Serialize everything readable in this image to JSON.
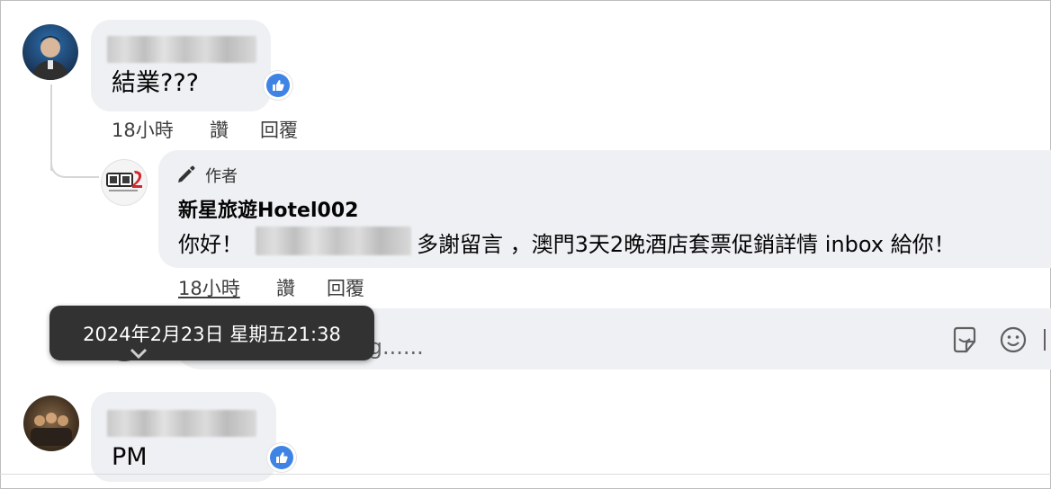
{
  "comments": [
    {
      "text": "結業???",
      "time": "18小時",
      "like_label": "讚",
      "reply_label": "回覆",
      "reaction": "like"
    },
    {
      "badge": "作者",
      "author": "新星旅遊Hotel002",
      "text_before": "你好！",
      "text_after": "多謝留言 ，澳門3天2晚酒店套票促銷詳情 inbox 給你！",
      "time": "18小時",
      "like_label": "讚",
      "reply_label": "回覆"
    },
    {
      "text": "PM",
      "reaction": "like"
    }
  ],
  "reply_box": {
    "placeholder_visible": "回覆 Kam Mei Pang......"
  },
  "tooltip": {
    "text": "2024年2月23日 星期五21:38"
  },
  "colors": {
    "bubble": "#eef0f3",
    "like_blue": "#3f84e5",
    "tooltip_bg": "#323232"
  },
  "icons": [
    "like-icon",
    "pencil-icon",
    "sticker-icon",
    "emoji-icon",
    "chevron-down-icon"
  ]
}
